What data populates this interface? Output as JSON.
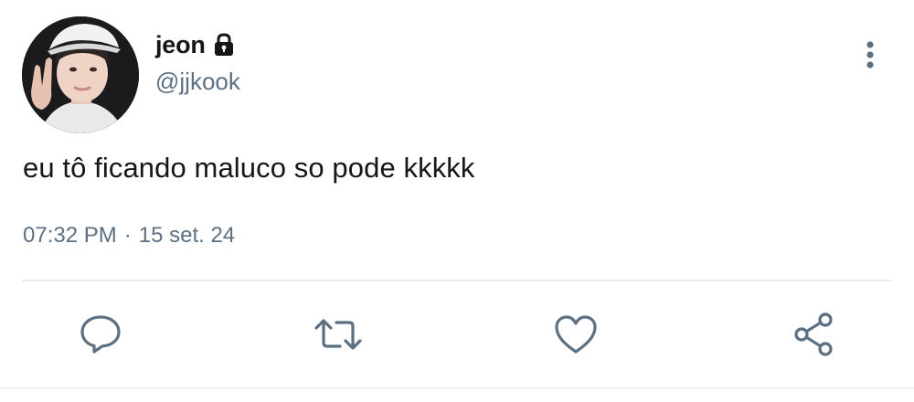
{
  "user": {
    "display_name": "jeon",
    "handle": "@jjkook",
    "avatar_icon": "profile-photo",
    "protected_icon": "lock-icon"
  },
  "tweet": {
    "text": "eu tô ficando maluco so pode kkkkk",
    "time": "07:32 PM",
    "separator": "·",
    "date": "15 set. 24"
  },
  "actions": [
    {
      "name": "reply",
      "icon": "comment-icon"
    },
    {
      "name": "retweet",
      "icon": "retweet-icon"
    },
    {
      "name": "like",
      "icon": "heart-icon"
    },
    {
      "name": "share",
      "icon": "share-icon"
    }
  ],
  "colors": {
    "text_primary": "#14171a",
    "text_secondary": "#5b7083",
    "icon": "#5b7083",
    "divider": "#e6ecf0"
  }
}
